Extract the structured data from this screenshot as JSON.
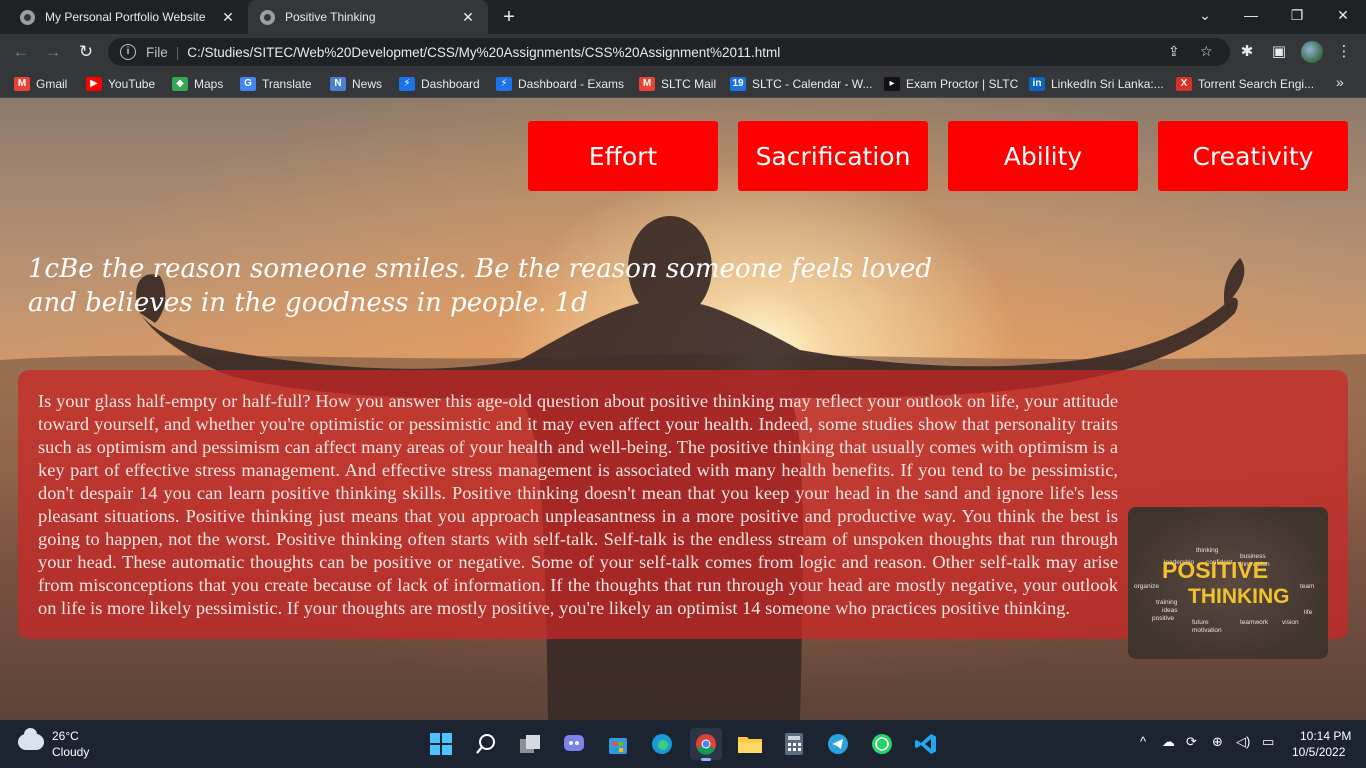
{
  "browser": {
    "tabs": [
      {
        "title": "My Personal Portfolio Website",
        "active": false
      },
      {
        "title": "Positive Thinking",
        "active": true
      }
    ],
    "close_glyph": "✕",
    "new_tab_glyph": "+",
    "window_controls": {
      "dropdown": "⌄",
      "minimize": "—",
      "restore": "❐",
      "close": "✕"
    },
    "omnibox": {
      "scheme_label": "File",
      "url": "C:/Studies/SITEC/Web%20Developmet/CSS/My%20Assignments/CSS%20Assignment%2011.html"
    },
    "bookmarks": [
      {
        "label": "Gmail",
        "icon": "gmail-icon",
        "color": "#ea4335",
        "glyph": "M"
      },
      {
        "label": "YouTube",
        "icon": "youtube-icon",
        "color": "#ff0000",
        "glyph": "▶"
      },
      {
        "label": "Maps",
        "icon": "maps-icon",
        "color": "#34a853",
        "glyph": "◆"
      },
      {
        "label": "Translate",
        "icon": "translate-icon",
        "color": "#4285f4",
        "glyph": "G"
      },
      {
        "label": "News",
        "icon": "news-icon",
        "color": "#4a7fd1",
        "glyph": "N"
      },
      {
        "label": "Dashboard",
        "icon": "dashboard-icon",
        "color": "#1a73e8",
        "glyph": "⚡"
      },
      {
        "label": "Dashboard - Exams",
        "icon": "dashboard-exams-icon",
        "color": "#1a73e8",
        "glyph": "⚡"
      },
      {
        "label": "SLTC Mail",
        "icon": "mail-icon",
        "color": "#ea4335",
        "glyph": "M"
      },
      {
        "label": "SLTC - Calendar - W...",
        "icon": "calendar-icon",
        "color": "#1a73e8",
        "glyph": "19"
      },
      {
        "label": "Exam Proctor | SLTC",
        "icon": "proctor-icon",
        "color": "#111111",
        "glyph": "▸"
      },
      {
        "label": "LinkedIn Sri Lanka:...",
        "icon": "linkedin-icon",
        "color": "#0a66c2",
        "glyph": "in"
      },
      {
        "label": "Torrent Search Engi...",
        "icon": "torrent-icon",
        "color": "#d93025",
        "glyph": "X"
      }
    ],
    "bookmarks_overflow": "»"
  },
  "page": {
    "nav_buttons": [
      "Effort",
      "Sacrification",
      "Ability",
      "Creativity"
    ],
    "quote": "1cBe the reason someone smiles. Be the reason someone feels loved and believes in the goodness in people. 1d",
    "paragraph": "Is your glass half-empty or half-full? How you answer this age-old question about positive thinking may reflect your outlook on life, your attitude toward yourself, and whether you're optimistic or pessimistic and it may even affect your health. Indeed, some studies show that personality traits such as optimism and pessimism can affect many areas of your health and well-being. The positive thinking that usually comes with optimism is a key part of effective stress management. And effective stress management is associated with many health benefits. If you tend to be pessimistic, don't despair 14 you can learn positive thinking skills. Positive thinking doesn't mean that you keep your head in the sand and ignore life's less pleasant situations. Positive thinking just means that you approach unpleasantness in a more positive and productive way. You think the best is going to happen, not the worst. Positive thinking often starts with self-talk. Self-talk is the endless stream of unspoken thoughts that run through your head. These automatic thoughts can be positive or negative. Some of your self-talk comes from logic and reason. Other self-talk may arise from misconceptions that you create because of lack of information. If the thoughts that run through your head are mostly negative, your outlook on life is more likely pessimistic. If your thoughts are mostly positive, you're likely an optimist 14 someone who practices positive thinking.",
    "word_cloud": {
      "main_1": "POSITIVE",
      "main_2": "THINKING",
      "small_words": [
        "leadership",
        "confident",
        "business",
        "innovation",
        "thinking",
        "organize",
        "team",
        "training",
        "ideas",
        "positive",
        "future",
        "teamwork",
        "vision",
        "motivation",
        "life",
        "management",
        "happiness"
      ]
    },
    "colors": {
      "button_bg": "#ff0000",
      "panel_bg": "rgba(205,38,38,0.72)"
    }
  },
  "taskbar": {
    "weather_temp": "26°C",
    "weather_desc": "Cloudy",
    "time": "10:14 PM",
    "date": "10/5/2022",
    "apps": [
      "start-icon",
      "search-icon",
      "task-view-icon",
      "teams-chat-icon",
      "store-icon",
      "edge-icon",
      "chrome-icon",
      "file-explorer-icon",
      "calculator-icon",
      "telegram-icon",
      "whatsapp-icon",
      "vscode-icon"
    ]
  }
}
